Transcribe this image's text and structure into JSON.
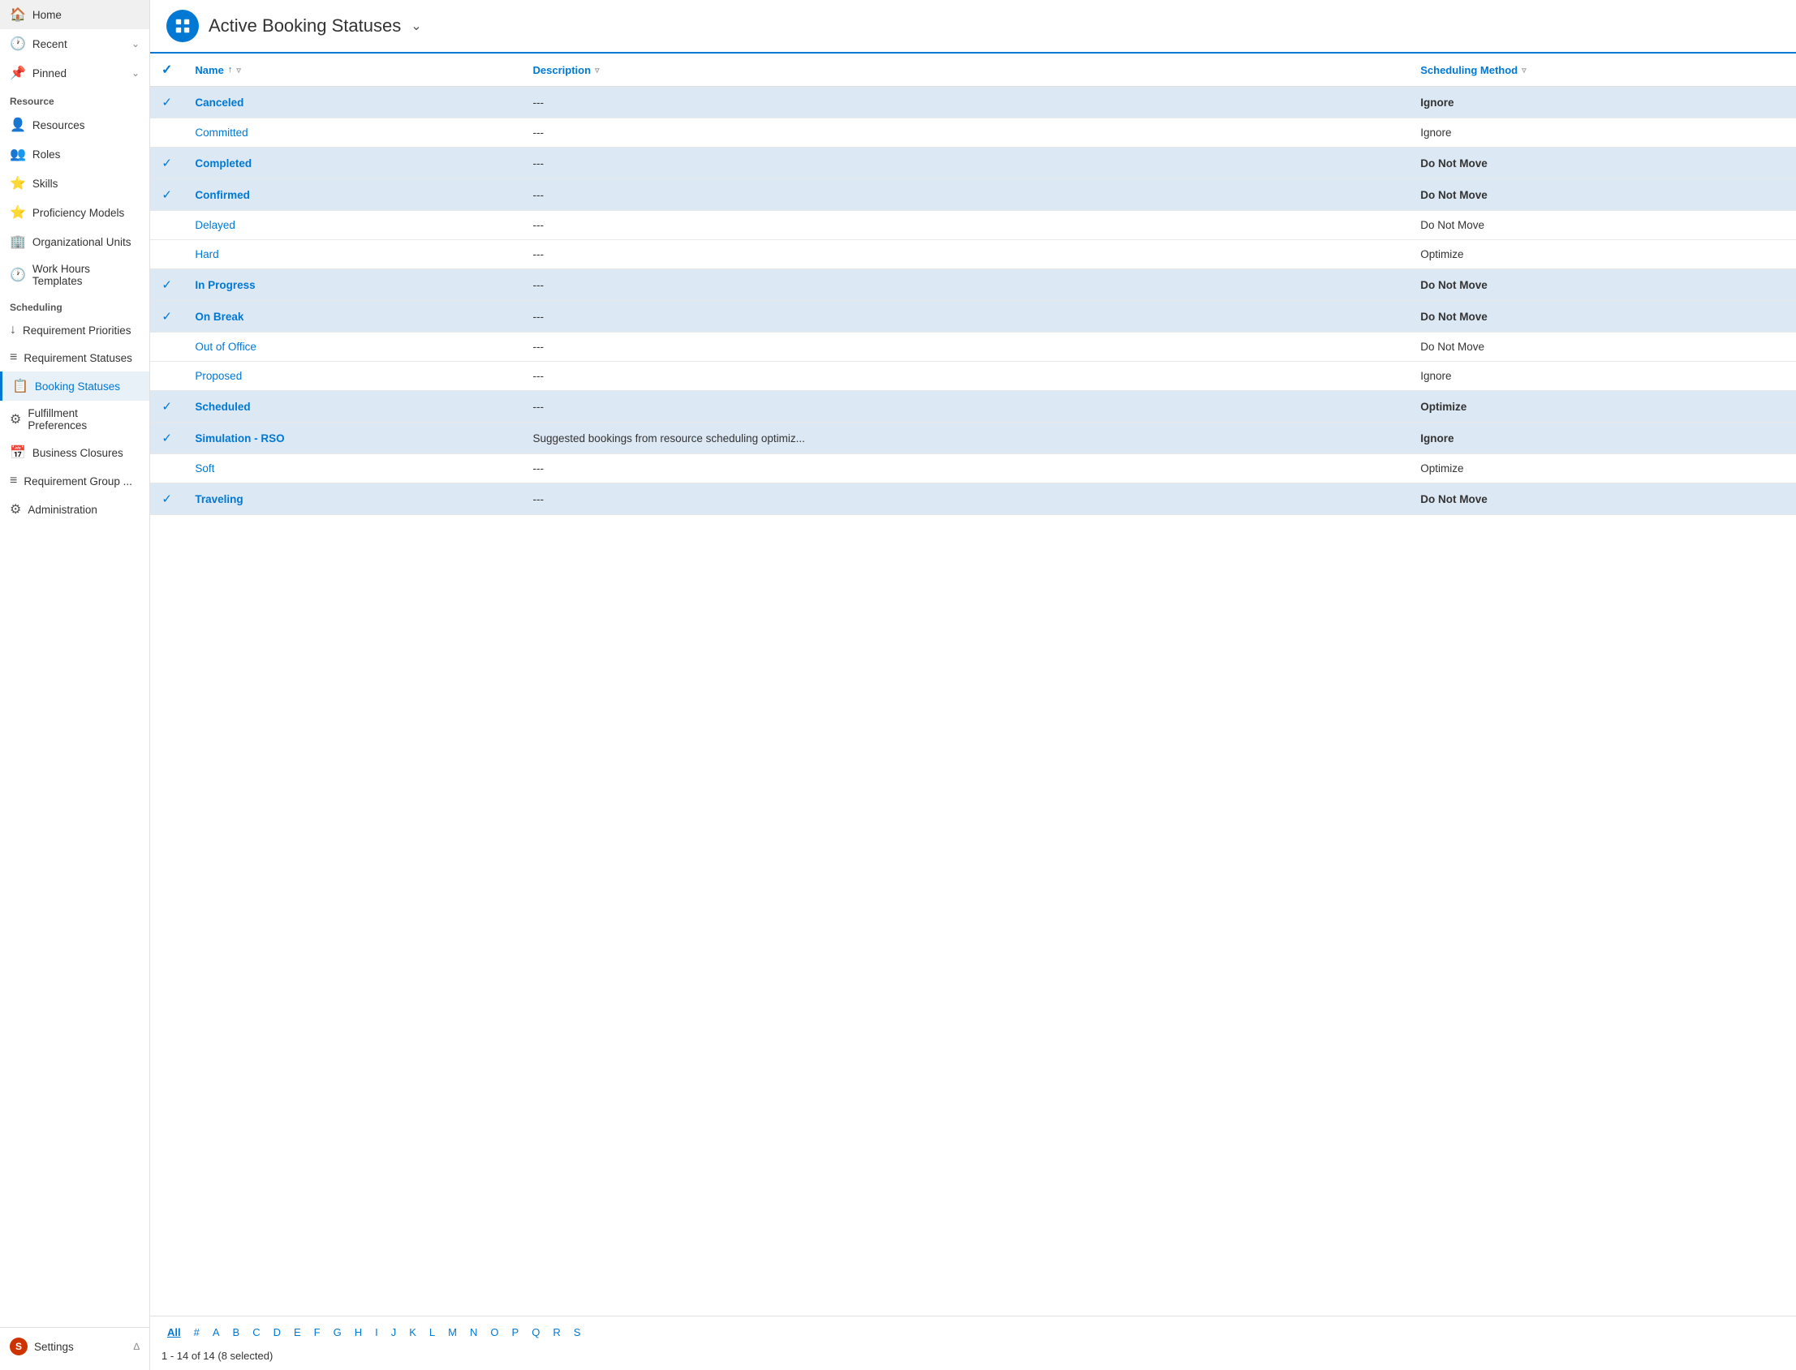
{
  "sidebar": {
    "nav_top": [
      {
        "id": "home",
        "label": "Home",
        "icon": "🏠"
      },
      {
        "id": "recent",
        "label": "Recent",
        "icon": "🕐",
        "chevron": true
      },
      {
        "id": "pinned",
        "label": "Pinned",
        "icon": "📌",
        "chevron": true
      }
    ],
    "sections": [
      {
        "label": "Resource",
        "items": [
          {
            "id": "resources",
            "label": "Resources",
            "icon": "👤"
          },
          {
            "id": "roles",
            "label": "Roles",
            "icon": "👥"
          },
          {
            "id": "skills",
            "label": "Skills",
            "icon": "⭐"
          },
          {
            "id": "proficiency-models",
            "label": "Proficiency Models",
            "icon": "⭐"
          },
          {
            "id": "organizational-units",
            "label": "Organizational Units",
            "icon": "🏢"
          },
          {
            "id": "work-hours-templates",
            "label": "Work Hours Templates",
            "icon": "🕐"
          }
        ]
      },
      {
        "label": "Scheduling",
        "items": [
          {
            "id": "requirement-priorities",
            "label": "Requirement Priorities",
            "icon": "↓"
          },
          {
            "id": "requirement-statuses",
            "label": "Requirement Statuses",
            "icon": "≡"
          },
          {
            "id": "booking-statuses",
            "label": "Booking Statuses",
            "icon": "📋",
            "active": true
          },
          {
            "id": "fulfillment-preferences",
            "label": "Fulfillment Preferences",
            "icon": "⚙"
          },
          {
            "id": "business-closures",
            "label": "Business Closures",
            "icon": "📅"
          },
          {
            "id": "requirement-group",
            "label": "Requirement Group ...",
            "icon": "≡"
          },
          {
            "id": "administration",
            "label": "Administration",
            "icon": "⚙"
          }
        ]
      }
    ],
    "bottom": [
      {
        "id": "settings",
        "label": "Settings",
        "icon": "S",
        "chevron": true
      }
    ]
  },
  "header": {
    "app_icon": "📋",
    "title": "Active Booking Statuses",
    "title_has_dropdown": true
  },
  "table": {
    "columns": [
      {
        "id": "check",
        "label": ""
      },
      {
        "id": "name",
        "label": "Name",
        "sortable": true,
        "filterable": true
      },
      {
        "id": "description",
        "label": "Description",
        "filterable": true
      },
      {
        "id": "scheduling_method",
        "label": "Scheduling Method",
        "filterable": true
      }
    ],
    "rows": [
      {
        "id": 1,
        "check": true,
        "name": "Canceled",
        "description": "---",
        "scheduling_method": "Ignore",
        "selected": true,
        "bold": true
      },
      {
        "id": 2,
        "check": false,
        "name": "Committed",
        "description": "---",
        "scheduling_method": "Ignore",
        "selected": false,
        "bold": false
      },
      {
        "id": 3,
        "check": true,
        "name": "Completed",
        "description": "---",
        "scheduling_method": "Do Not Move",
        "selected": true,
        "bold": true
      },
      {
        "id": 4,
        "check": true,
        "name": "Confirmed",
        "description": "---",
        "scheduling_method": "Do Not Move",
        "selected": true,
        "bold": true
      },
      {
        "id": 5,
        "check": false,
        "name": "Delayed",
        "description": "---",
        "scheduling_method": "Do Not Move",
        "selected": false,
        "bold": false
      },
      {
        "id": 6,
        "check": false,
        "name": "Hard",
        "description": "---",
        "scheduling_method": "Optimize",
        "selected": false,
        "bold": false
      },
      {
        "id": 7,
        "check": true,
        "name": "In Progress",
        "description": "---",
        "scheduling_method": "Do Not Move",
        "selected": true,
        "bold": true
      },
      {
        "id": 8,
        "check": true,
        "name": "On Break",
        "description": "---",
        "scheduling_method": "Do Not Move",
        "selected": true,
        "bold": true
      },
      {
        "id": 9,
        "check": false,
        "name": "Out of Office",
        "description": "---",
        "scheduling_method": "Do Not Move",
        "selected": false,
        "bold": false
      },
      {
        "id": 10,
        "check": false,
        "name": "Proposed",
        "description": "---",
        "scheduling_method": "Ignore",
        "selected": false,
        "bold": false
      },
      {
        "id": 11,
        "check": true,
        "name": "Scheduled",
        "description": "---",
        "scheduling_method": "Optimize",
        "selected": true,
        "bold": true
      },
      {
        "id": 12,
        "check": true,
        "name": "Simulation - RSO",
        "description": "Suggested bookings from resource scheduling optimiz...",
        "scheduling_method": "Ignore",
        "selected": true,
        "bold": true
      },
      {
        "id": 13,
        "check": false,
        "name": "Soft",
        "description": "---",
        "scheduling_method": "Optimize",
        "selected": false,
        "bold": false
      },
      {
        "id": 14,
        "check": true,
        "name": "Traveling",
        "description": "---",
        "scheduling_method": "Do Not Move",
        "selected": true,
        "bold": true
      }
    ]
  },
  "pagination": {
    "alpha_options": [
      "All",
      "#",
      "A",
      "B",
      "C",
      "D",
      "E",
      "F",
      "G",
      "H",
      "I",
      "J",
      "K",
      "L",
      "M",
      "N",
      "O",
      "P",
      "Q",
      "R",
      "S"
    ],
    "active_alpha": "All",
    "page_info": "1 - 14 of 14 (8 selected)"
  }
}
